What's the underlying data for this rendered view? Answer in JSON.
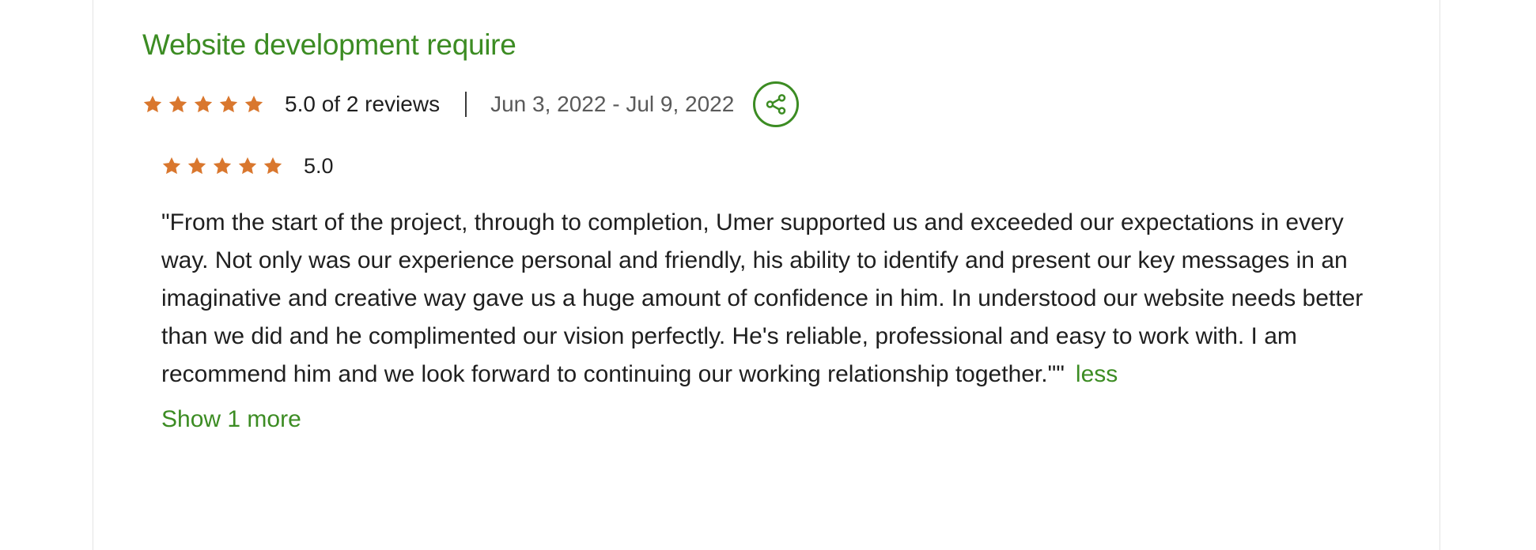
{
  "project": {
    "title": "Website development require",
    "overall_rating": 5.0,
    "overall_stars": 5,
    "summary_text": "5.0 of 2 reviews",
    "date_range": "Jun 3, 2022 - Jul 9, 2022",
    "share_icon": "share-icon"
  },
  "review": {
    "stars": 5,
    "score_text": "5.0",
    "text": "\"From the start of the project, through to completion, Umer supported us and exceeded our expectations in every way. Not only was our experience personal and friendly, his ability to identify and present our key messages in an imaginative and creative way gave us a huge amount of confidence in him. In understood our website needs better than we did and he complimented our vision perfectly. He's reliable, professional and easy to work with. I am recommend him and we look forward to continuing our working relationship together.\"\"",
    "less_label": "less"
  },
  "show_more_label": "Show 1 more",
  "colors": {
    "accent_green": "#3c8c23",
    "star_orange": "#d9772e",
    "text_dark": "#1f1f1f",
    "text_muted": "#5a5a5a"
  }
}
